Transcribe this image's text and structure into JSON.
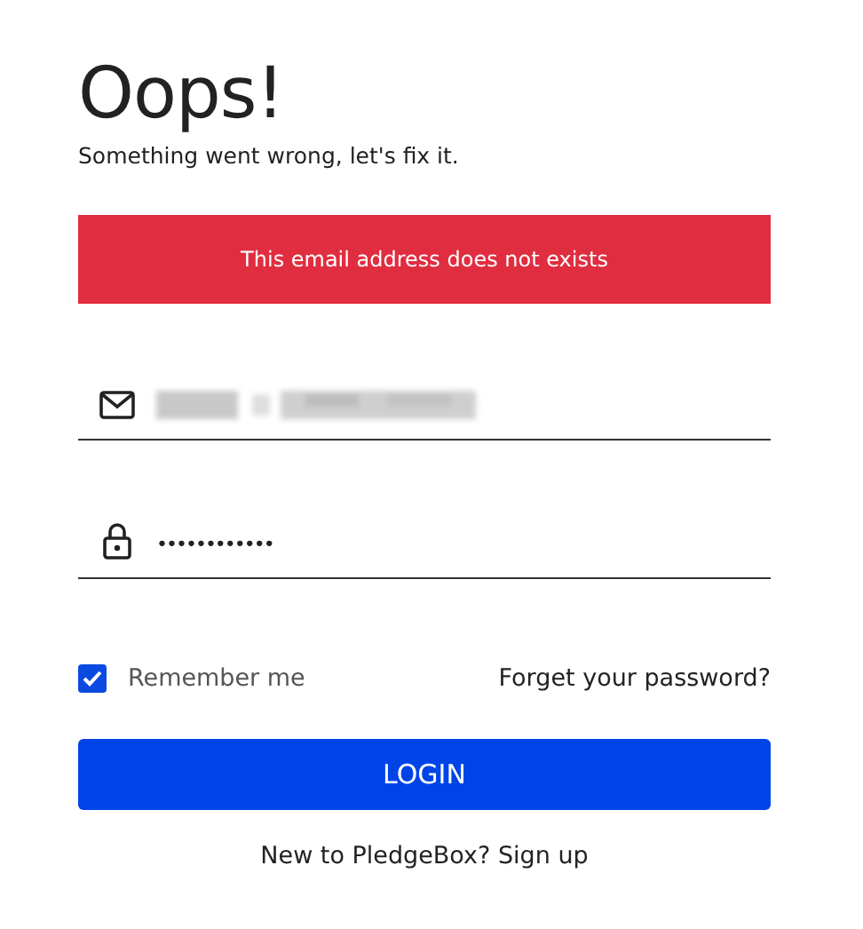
{
  "heading": "Oops!",
  "subheading": "Something went wrong, let's fix it.",
  "error_banner": "This email address does not exists",
  "email_field": {
    "value_redacted": true
  },
  "password_field": {
    "value": "••••••••••••"
  },
  "remember_me": {
    "label": "Remember me",
    "checked": true
  },
  "forgot_link": "Forget your password?",
  "login_button": "LOGIN",
  "signup": {
    "prompt": "New to PledgeBox?",
    "link": "Sign up"
  }
}
